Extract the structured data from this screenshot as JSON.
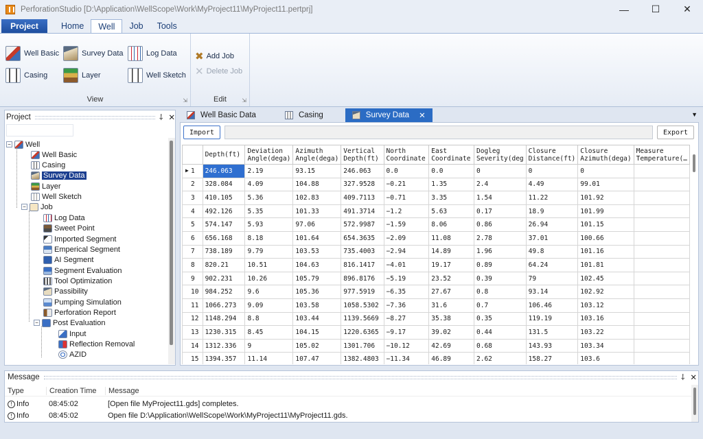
{
  "window": {
    "title": "PerforationStudio [D:\\Application\\WellScope\\Work\\MyProject11\\MyProject11.pertprj]"
  },
  "menu": {
    "project": "Project",
    "tabs": [
      "Home",
      "Well",
      "Job",
      "Tools"
    ],
    "active_tab": "Well"
  },
  "ribbon": {
    "view_group": {
      "label": "View",
      "buttons": [
        "Well Basic",
        "Survey Data",
        "Log Data",
        "Casing",
        "Layer",
        "Well Sketch"
      ]
    },
    "edit_group": {
      "label": "Edit",
      "buttons": [
        "Add Job",
        "Delete Job"
      ]
    }
  },
  "doc_tabs": [
    {
      "label": "Well Basic Data",
      "icon": "well-icon"
    },
    {
      "label": "Casing",
      "icon": "casing-icon"
    },
    {
      "label": "Survey Data",
      "icon": "survey-icon",
      "active": true
    }
  ],
  "project_panel": {
    "title": "Project",
    "pin": "’",
    "close": "✕",
    "tree": [
      {
        "label": "Well",
        "level": 0,
        "icon": "rig-icon",
        "expander": "−"
      },
      {
        "label": "Well Basic",
        "level": 1,
        "icon": "rig-icon"
      },
      {
        "label": "Casing",
        "level": 1,
        "icon": "casing-icon"
      },
      {
        "label": "Survey Data",
        "level": 1,
        "icon": "survey-icon",
        "selected": true
      },
      {
        "label": "Layer",
        "level": 1,
        "icon": "layer-icon"
      },
      {
        "label": "Well Sketch",
        "level": 1,
        "icon": "sketch-icon"
      },
      {
        "label": "Job",
        "level": 1,
        "icon": "job-icon",
        "expander": "−"
      },
      {
        "label": "Log Data",
        "level": 2,
        "icon": "log-icon"
      },
      {
        "label": "Sweet Point",
        "level": 2,
        "icon": "sweet-point-icon"
      },
      {
        "label": "Imported Segment",
        "level": 2,
        "icon": "flag-icon"
      },
      {
        "label": "Emperical Segment",
        "level": 2,
        "icon": "segment-icon"
      },
      {
        "label": "AI Segment",
        "level": 2,
        "icon": "ai-icon"
      },
      {
        "label": "Segment Evaluation",
        "level": 2,
        "icon": "evaluation-icon"
      },
      {
        "label": "Tool Optimization",
        "level": 2,
        "icon": "tool-icon"
      },
      {
        "label": "Passibility",
        "level": 2,
        "icon": "passibility-icon"
      },
      {
        "label": "Pumping Simulation",
        "level": 2,
        "icon": "pump-icon"
      },
      {
        "label": "Perforation Report",
        "level": 2,
        "icon": "report-icon"
      },
      {
        "label": "Post Evaluation",
        "level": 2,
        "icon": "post-eval-icon",
        "expander": "−"
      },
      {
        "label": "Input",
        "level": 3,
        "icon": "input-icon"
      },
      {
        "label": "Reflection Removal",
        "level": 3,
        "icon": "reflection-icon"
      },
      {
        "label": "AZID",
        "level": 3,
        "icon": "azid-icon"
      }
    ]
  },
  "survey": {
    "import_label": "Import",
    "export_label": "Export",
    "columns": [
      "Depth(ft)",
      "Deviation Angle(dega)",
      "Azimuth Angle(dega)",
      "Vertical Depth(ft)",
      "North Coordinate",
      "East Coordinate",
      "Dogleg Severity(deg",
      "Closure Distance(ft)",
      "Closure Azimuth(dega)",
      "Measure Temperature(…"
    ],
    "rows": [
      [
        "1",
        "246.063",
        "2.19",
        "93.15",
        "246.063",
        "0.0",
        "0.0",
        "0",
        "0",
        "0",
        ""
      ],
      [
        "2",
        "328.084",
        "4.09",
        "104.88",
        "327.9528",
        "−0.21",
        "1.35",
        "2.4",
        "4.49",
        "99.01",
        ""
      ],
      [
        "3",
        "410.105",
        "5.36",
        "102.83",
        "409.7113",
        "−0.71",
        "3.35",
        "1.54",
        "11.22",
        "101.92",
        ""
      ],
      [
        "4",
        "492.126",
        "5.35",
        "101.33",
        "491.3714",
        "−1.2",
        "5.63",
        "0.17",
        "18.9",
        "101.99",
        ""
      ],
      [
        "5",
        "574.147",
        "5.93",
        "97.06",
        "572.9987",
        "−1.59",
        "8.06",
        "0.86",
        "26.94",
        "101.15",
        ""
      ],
      [
        "6",
        "656.168",
        "8.18",
        "101.64",
        "654.3635",
        "−2.09",
        "11.08",
        "2.78",
        "37.01",
        "100.66",
        ""
      ],
      [
        "7",
        "738.189",
        "9.79",
        "103.53",
        "735.4003",
        "−2.94",
        "14.89",
        "1.96",
        "49.8",
        "101.16",
        ""
      ],
      [
        "8",
        "820.21",
        "10.51",
        "104.63",
        "816.1417",
        "−4.01",
        "19.17",
        "0.89",
        "64.24",
        "101.81",
        ""
      ],
      [
        "9",
        "902.231",
        "10.26",
        "105.79",
        "896.8176",
        "−5.19",
        "23.52",
        "0.39",
        "79",
        "102.45",
        ""
      ],
      [
        "10",
        "984.252",
        "9.6",
        "105.36",
        "977.5919",
        "−6.35",
        "27.67",
        "0.8",
        "93.14",
        "102.92",
        ""
      ],
      [
        "11",
        "1066.273",
        "9.09",
        "103.58",
        "1058.5302",
        "−7.36",
        "31.6",
        "0.7",
        "106.46",
        "103.12",
        ""
      ],
      [
        "12",
        "1148.294",
        "8.8",
        "103.44",
        "1139.5669",
        "−8.27",
        "35.38",
        "0.35",
        "119.19",
        "103.16",
        ""
      ],
      [
        "13",
        "1230.315",
        "8.45",
        "104.15",
        "1220.6365",
        "−9.17",
        "39.02",
        "0.44",
        "131.5",
        "103.22",
        ""
      ],
      [
        "14",
        "1312.336",
        "9",
        "105.02",
        "1301.706",
        "−10.12",
        "42.69",
        "0.68",
        "143.93",
        "103.34",
        ""
      ],
      [
        "15",
        "1394.357",
        "11.14",
        "107.47",
        "1382.4803",
        "−11.34",
        "46.89",
        "2.62",
        "158.27",
        "103.6",
        ""
      ]
    ]
  },
  "message_panel": {
    "title": "Message",
    "columns": [
      "Type",
      "Creation Time",
      "Message"
    ],
    "rows": [
      {
        "type": "Info",
        "time": "08:45:02",
        "message": "[Open file MyProject11.gds] completes."
      },
      {
        "type": "Info",
        "time": "08:45:02",
        "message": "Open file D:\\Application\\WellScope\\Work\\MyProject11\\MyProject11.gds."
      }
    ]
  },
  "colors": {
    "accent": "#2b6cc4",
    "project_menu": "#1f4f9f",
    "selected_cell": "#2f6fd0"
  }
}
